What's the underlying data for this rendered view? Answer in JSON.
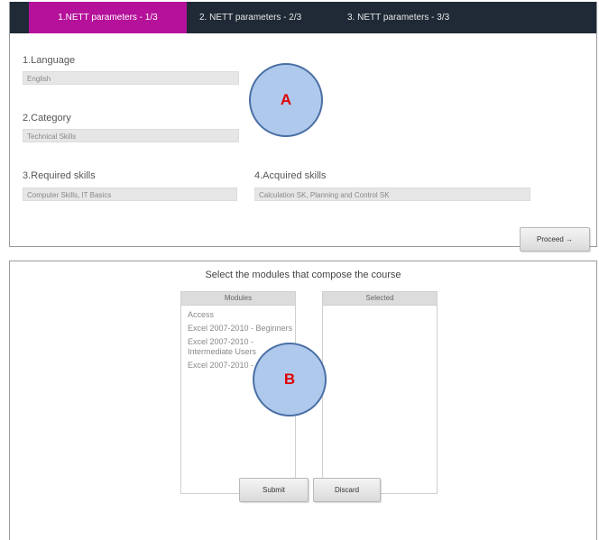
{
  "tabs": [
    {
      "label": "1.NETT parameters - 1/3",
      "active": true
    },
    {
      "label": "2. NETT parameters - 2/3",
      "active": false
    },
    {
      "label": "3. NETT parameters - 3/3",
      "active": false
    }
  ],
  "params": {
    "language_label": "1.Language",
    "language_value": "English",
    "category_label": "2.Category",
    "category_value": "Technical Skills",
    "required_label": "3.Required skills",
    "required_value": "Computer Skills, IT Basics",
    "acquired_label": "4.Acquired skills",
    "acquired_value": "Calculation SK, Planning and Control SK",
    "proceed_label": "Proceed →"
  },
  "modules": {
    "instruction": "Select the modules that compose the course",
    "modules_header": "Modules",
    "selected_header": "Selected",
    "items": [
      "Access",
      "Excel 2007-2010 - Beginners",
      "Excel 2007-2010 - Intermediate Users",
      "Excel 2007-2010 - Advanced"
    ],
    "submit_label": "Submit",
    "discard_label": "Discard"
  },
  "callouts": {
    "a": "A",
    "b": "B"
  },
  "colors": {
    "tabbar": "#1f2a36",
    "active_tab": "#b5119a",
    "callout_fill": "#afc9ec",
    "callout_text": "#e00000"
  }
}
